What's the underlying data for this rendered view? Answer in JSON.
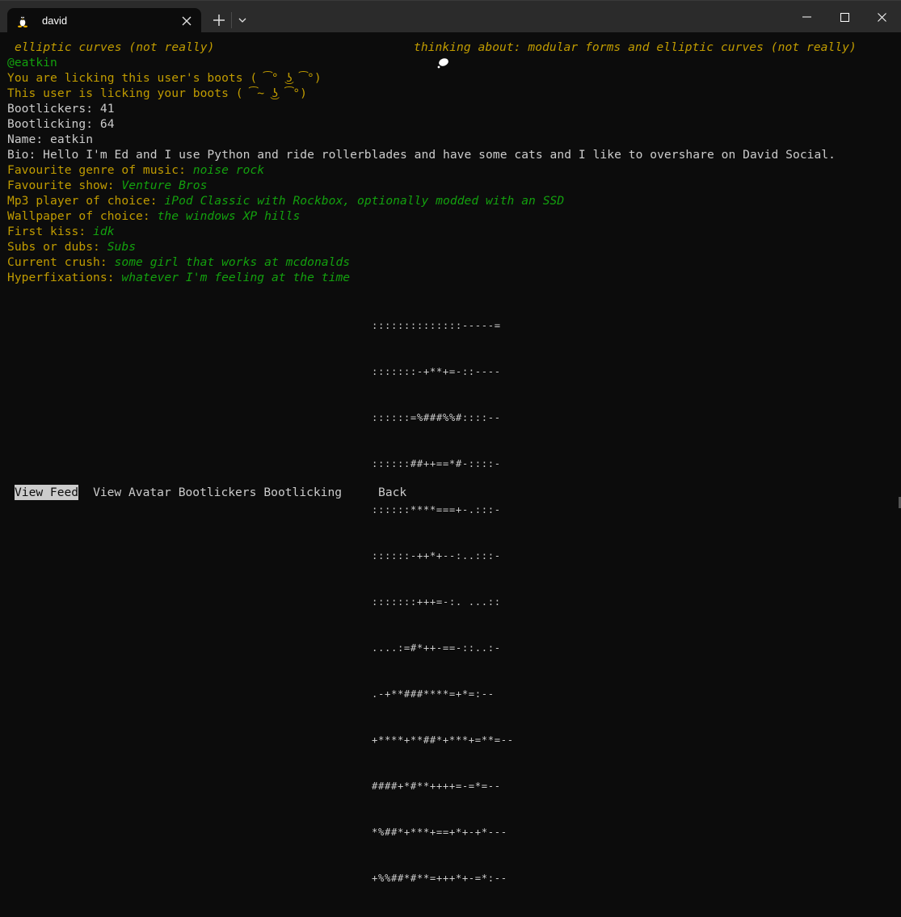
{
  "window": {
    "tab_title": "david",
    "tab_icon": "linux-penguin-icon",
    "controls": {
      "minimize": "—",
      "maximize": "☐",
      "close": "✕"
    }
  },
  "profile": {
    "status_left": "elliptic curves (not really)",
    "thinking_icon": "thought-bubble-icon",
    "status_right": "thinking about: modular forms and elliptic curves (not really)",
    "handle": "@eatkin",
    "you_licking": "You are licking this user's boots ( ͡° ͜ʖ ͡°)",
    "user_licking": "This user is licking your boots ( ͡~ ͜ʖ ͡°)",
    "bootlickers": "Bootlickers: 41",
    "bootlicking": "Bootlicking: 64",
    "name": "Name: eatkin",
    "bio": "Bio: Hello I'm Ed and I use Python and ride rollerblades and have some cats and I like to overshare on David Social.",
    "fields": [
      {
        "label": "Favourite genre of music: ",
        "value": "noise rock"
      },
      {
        "label": "Favourite show: ",
        "value": "Venture Bros"
      },
      {
        "label": "Mp3 player of choice: ",
        "value": "iPod Classic with Rockbox, optionally modded with an SSD"
      },
      {
        "label": "Wallpaper of choice: ",
        "value": "the windows XP hills"
      },
      {
        "label": "First kiss: ",
        "value": "idk"
      },
      {
        "label": "Subs or dubs: ",
        "value": "Subs"
      },
      {
        "label": "Current crush: ",
        "value": "some girl that works at mcdonalds"
      },
      {
        "label": "Hyperfixations: ",
        "value": "whatever I'm feeling at the time"
      }
    ]
  },
  "avatar_ascii": [
    "::::::::::::::-----=",
    ":::::::-+**+=-::----",
    "::::::=%###%%#::::--",
    "::::::##++==*#-::::-",
    "::::::****===+-.:::-",
    "::::::-++*+--:..:::-",
    ":::::::+++=-:. ...::",
    "....:=#*++-==-::..:-",
    ".-+**###****=+*=:--",
    "+****+**##*+***+=**=--",
    "####+*#**++++=-=*=--",
    "*%##*+***+==+*+-+*---",
    "+%%##*#**=+++*+-=*:--"
  ],
  "menu": {
    "items": [
      "View Feed",
      "View Avatar",
      "Bootlickers",
      "Bootlicking",
      "Back"
    ],
    "selected": "View Feed"
  },
  "colors": {
    "background": "#0c0c0c",
    "titlebar": "#2b2b2b",
    "text": "#cccccc",
    "yellow": "#c19c00",
    "green": "#13a10e"
  }
}
